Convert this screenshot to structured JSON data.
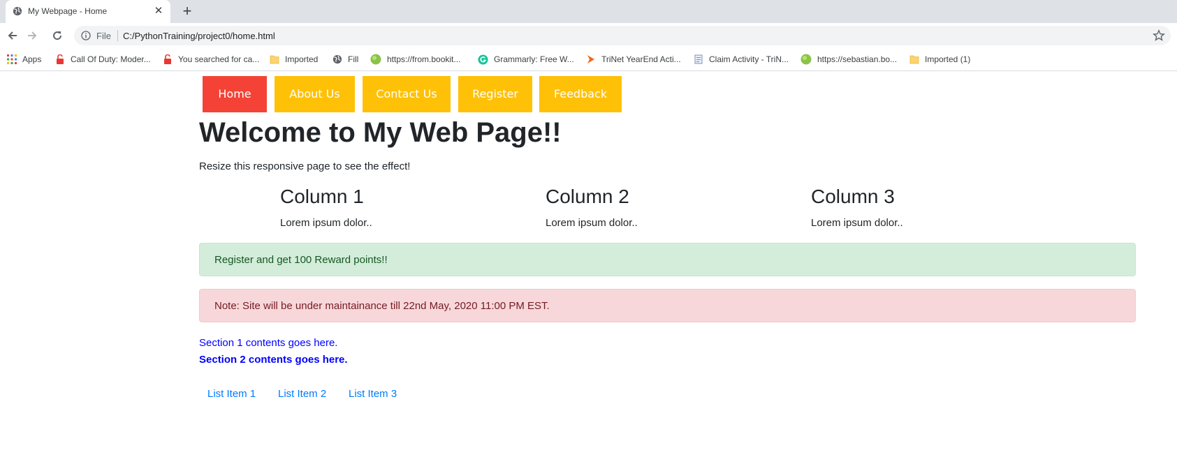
{
  "browser": {
    "tab": {
      "title": "My Webpage - Home",
      "favicon": "globe-icon",
      "close_glyph": "✕"
    },
    "new_tab_glyph": "+",
    "omnibox": {
      "scheme_label": "File",
      "url": "C:/PythonTraining/project0/home.html"
    },
    "bookmarks": [
      {
        "label": "Apps",
        "icon": "apps-grid-icon"
      },
      {
        "label": "Call Of Duty: Moder...",
        "icon": "lock-icon"
      },
      {
        "label": "You searched for ca...",
        "icon": "lock-icon"
      },
      {
        "label": "Imported",
        "icon": "folder-icon"
      },
      {
        "label": "Fill",
        "icon": "globe-icon"
      },
      {
        "label": "https://from.bookit...",
        "icon": "green-ball-icon"
      },
      {
        "label": "Grammarly: Free W...",
        "icon": "grammarly-icon"
      },
      {
        "label": "TriNet YearEnd Acti...",
        "icon": "trinet-icon"
      },
      {
        "label": "Claim Activity - TriN...",
        "icon": "document-icon"
      },
      {
        "label": "https://sebastian.bo...",
        "icon": "green-ball-icon"
      },
      {
        "label": "Imported (1)",
        "icon": "folder-icon"
      }
    ]
  },
  "page": {
    "nav": [
      {
        "label": "Home",
        "active": true
      },
      {
        "label": "About Us",
        "active": false
      },
      {
        "label": "Contact Us",
        "active": false
      },
      {
        "label": "Register",
        "active": false
      },
      {
        "label": "Feedback",
        "active": false
      }
    ],
    "heading": "Welcome to My Web Page!!",
    "intro": "Resize this responsive page to see the effect!",
    "columns": [
      {
        "title": "Column 1",
        "text": "Lorem ipsum dolor.."
      },
      {
        "title": "Column 2",
        "text": "Lorem ipsum dolor.."
      },
      {
        "title": "Column 3",
        "text": "Lorem ipsum dolor.."
      }
    ],
    "alert_success": "Register and get 100 Reward points!!",
    "alert_danger": "Note: Site will be under maintainance till 22nd May, 2020 11:00 PM EST.",
    "section1": "Section 1 contents goes here.",
    "section2": "Section 2 contents goes here.",
    "list_items": [
      "List Item 1",
      "List Item 2",
      "List Item 3"
    ]
  },
  "colors": {
    "nav_active": "#f44336",
    "nav_inactive": "#ffc107",
    "alert_success_bg": "#d4edda",
    "alert_danger_bg": "#f8d7da",
    "section_link": "#0000ff",
    "list_link": "#007bff"
  }
}
